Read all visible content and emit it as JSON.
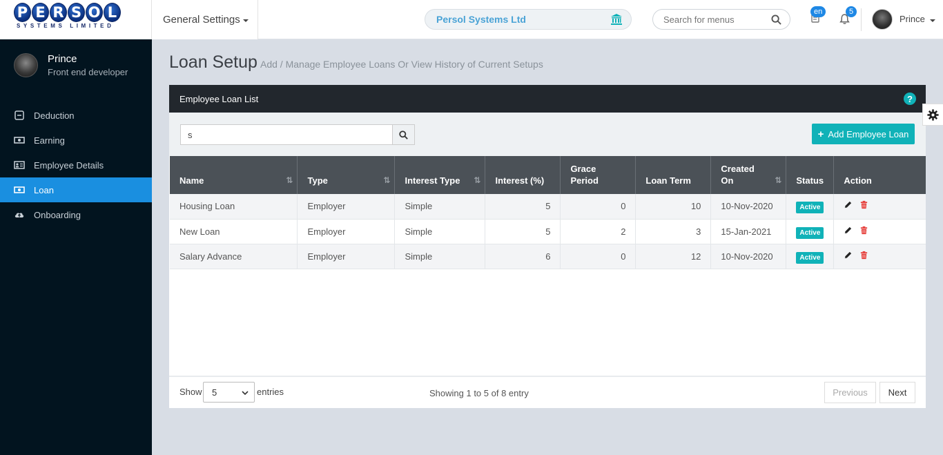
{
  "brand": {
    "logo_letters": [
      "P",
      "E",
      "R",
      "S",
      "O",
      "L"
    ],
    "logo_subtitle": "SYSTEMS LIMITED"
  },
  "topbar": {
    "menu_label": "General Settings",
    "company": "Persol Systems Ltd",
    "search_placeholder": "Search for menus",
    "lang_badge": "en",
    "notif_count": "5",
    "user_name": "Prince"
  },
  "sidebar": {
    "profile": {
      "name": "Prince",
      "role": "Front end developer"
    },
    "items": [
      {
        "label": "Deduction",
        "icon": "minus-square-icon",
        "active": false
      },
      {
        "label": "Earning",
        "icon": "money-icon",
        "active": false
      },
      {
        "label": "Employee Details",
        "icon": "id-card-icon",
        "active": false
      },
      {
        "label": "Loan",
        "icon": "money-icon",
        "active": true
      },
      {
        "label": "Onboarding",
        "icon": "cloud-upload-icon",
        "active": false
      }
    ]
  },
  "page": {
    "title": "Loan Setup",
    "subtitle": "Add / Manage Employee Loans Or View History of Current Setups"
  },
  "panel": {
    "title": "Employee Loan List",
    "filter_value": "s",
    "add_label": "Add Employee Loan",
    "columns": [
      "Name",
      "Type",
      "Interest Type",
      "Interest (%)",
      "Grace Period",
      "Loan Term",
      "Created On",
      "Status",
      "Action"
    ],
    "rows": [
      {
        "name": "Housing Loan",
        "type": "Employer",
        "interest_type": "Simple",
        "interest": "5",
        "grace": "0",
        "term": "10",
        "created": "10-Nov-2020",
        "status": "Active"
      },
      {
        "name": "New Loan",
        "type": "Employer",
        "interest_type": "Simple",
        "interest": "5",
        "grace": "2",
        "term": "3",
        "created": "15-Jan-2021",
        "status": "Active"
      },
      {
        "name": "Salary Advance",
        "type": "Employer",
        "interest_type": "Simple",
        "interest": "6",
        "grace": "0",
        "term": "12",
        "created": "10-Nov-2020",
        "status": "Active"
      }
    ],
    "footer": {
      "show_label": "Show",
      "page_size": "5",
      "entries_label": "entries",
      "showing": "Showing 1 to 5 of 8 entry",
      "prev": "Previous",
      "next": "Next"
    }
  },
  "colors": {
    "sidebar_bg": "#02141f",
    "active_nav": "#1a8fe0",
    "teal_accent": "#10b2b8",
    "header_dark": "#22272d",
    "table_head": "#4b5157"
  }
}
